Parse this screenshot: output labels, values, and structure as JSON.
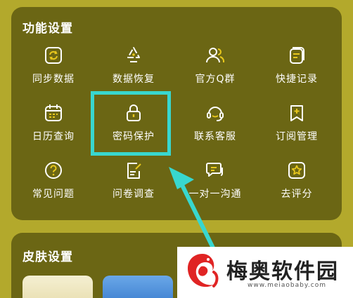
{
  "section_functions": {
    "title": "功能设置",
    "items": [
      {
        "label": "同步数据",
        "icon": "sync-icon"
      },
      {
        "label": "数据恢复",
        "icon": "recycle-icon"
      },
      {
        "label": "官方Q群",
        "icon": "group-icon"
      },
      {
        "label": "快捷记录",
        "icon": "notes-icon"
      },
      {
        "label": "日历查询",
        "icon": "calendar-icon"
      },
      {
        "label": "密码保护",
        "icon": "lock-icon"
      },
      {
        "label": "联系客服",
        "icon": "headset-icon"
      },
      {
        "label": "订阅管理",
        "icon": "bookmark-icon"
      },
      {
        "label": "常见问题",
        "icon": "question-icon"
      },
      {
        "label": "问卷调查",
        "icon": "survey-icon"
      },
      {
        "label": "一对一沟通",
        "icon": "chat-icon"
      },
      {
        "label": "去评分",
        "icon": "star-icon"
      }
    ]
  },
  "section_skin": {
    "title": "皮肤设置"
  },
  "watermark": {
    "title": "梅奥软件园",
    "url": "www.meiaobaby.com"
  },
  "colors": {
    "background": "#b3a92c",
    "card": "#6b6614",
    "icon_accent": "#e9c81c",
    "highlight": "#38d7cf"
  }
}
